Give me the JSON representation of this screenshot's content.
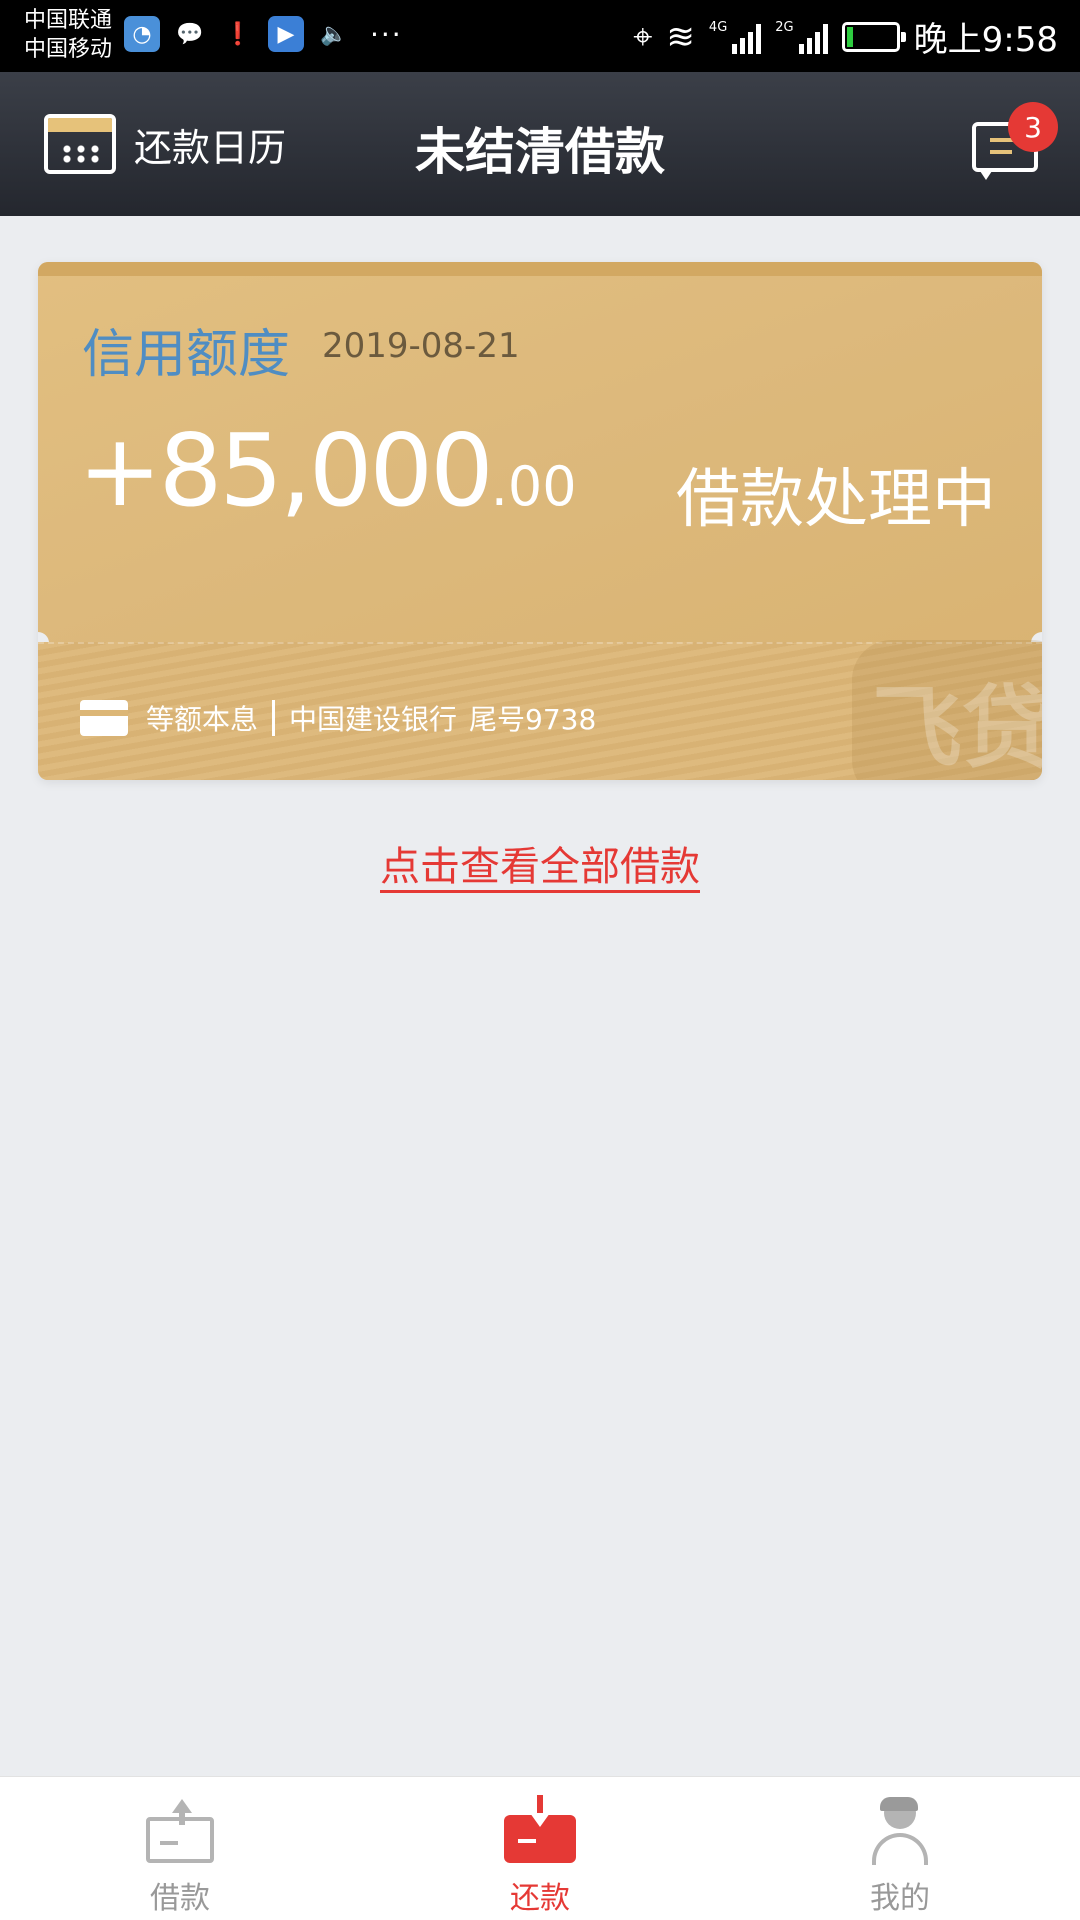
{
  "status_bar": {
    "carrier_1": "中国联通",
    "carrier_2": "中国移动",
    "more": "···",
    "net_1": "4G",
    "net_2": "2G",
    "time": "晚上9:58"
  },
  "header": {
    "calendar_label": "还款日历",
    "title": "未结清借款",
    "message_badge": "3"
  },
  "card": {
    "label": "信用额度",
    "date": "2019-08-21",
    "amount_main": "+85,000",
    "amount_decimal": ".00",
    "status": "借款处理中",
    "repay_method": "等额本息",
    "bank": "中国建设银行",
    "card_tail": "尾号9738",
    "watermark": "飞贷"
  },
  "view_all_link": "点击查看全部借款",
  "bottom_nav": {
    "items": [
      {
        "label": "借款",
        "icon": "borrow-icon"
      },
      {
        "label": "还款",
        "icon": "repay-icon"
      },
      {
        "label": "我的",
        "icon": "profile-icon"
      }
    ],
    "active_index": 1
  },
  "colors": {
    "accent_red": "#e53935",
    "card_gold": "#ddb97c",
    "label_blue": "#4f8dc3",
    "header_dark": "#2e3139"
  }
}
